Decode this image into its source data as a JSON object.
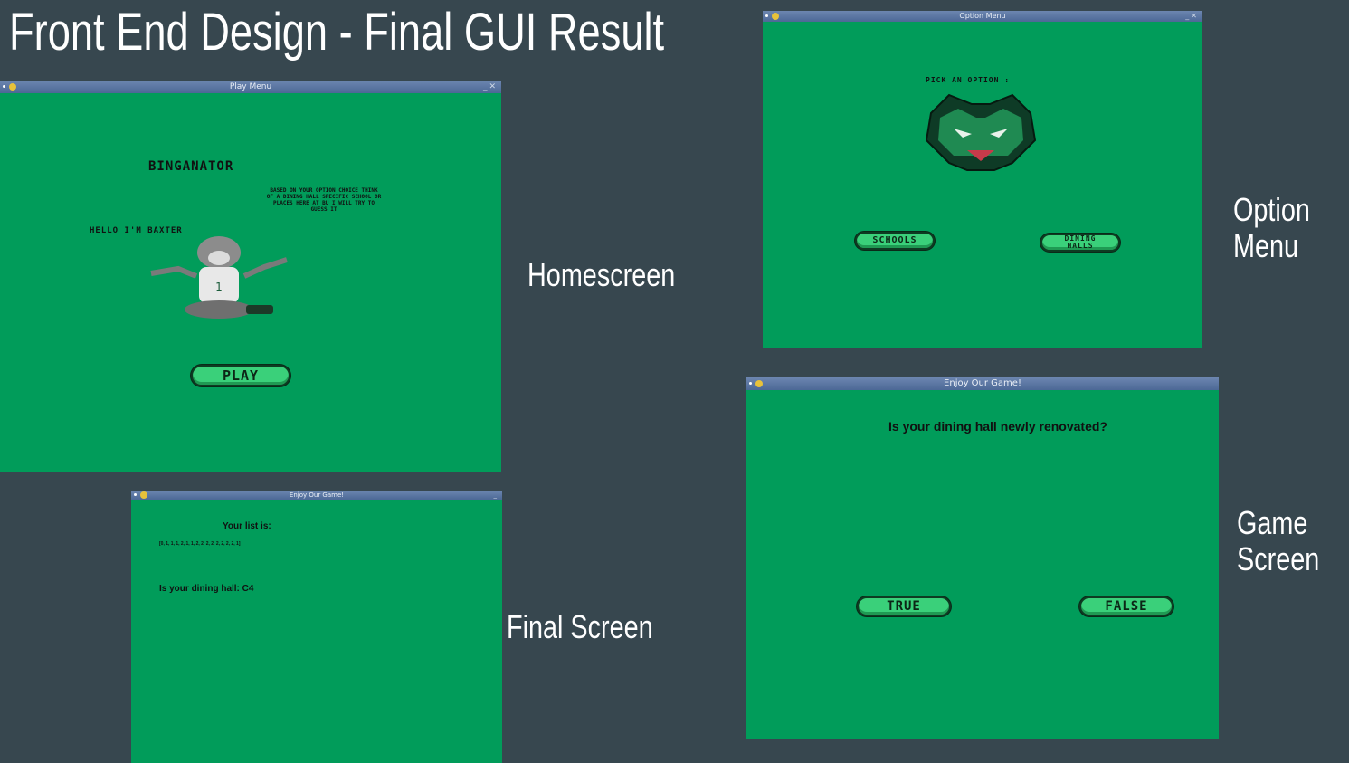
{
  "slide": {
    "title": "Front End Design - Final GUI Result",
    "captions": {
      "homescreen": "Homescreen",
      "option_menu_line1": "Option",
      "option_menu_line2": "Menu",
      "final_screen": "Final Screen",
      "game_screen_line1": "Game",
      "game_screen_line2": "Screen"
    }
  },
  "play_window": {
    "title": "Play Menu",
    "heading": "BINGANATOR",
    "description_lines": [
      "BASED ON YOUR OPTION CHOICE THINK",
      "OF A DINING HALL SPECIFIC SCHOOL OR",
      "PLACES HERE AT BU I WILL TRY TO",
      "GUESS IT"
    ],
    "hello": "HELLO I'M BAXTER",
    "play_button": "PLAY"
  },
  "option_window": {
    "title": "Option Menu",
    "prompt": "PICK AN OPTION :",
    "schools_button": "SCHOOLS",
    "dining_button_line1": "DINING",
    "dining_button_line2": "HALLS"
  },
  "final_window": {
    "title": "Enjoy Our Game!",
    "list_label": "Your list is:",
    "list_value": "[0, 1, 1, 1, 2, 1, 1, 2, 2, 2, 2, 2, 2, 2, 2, 1]",
    "result_text": "Is your dining hall: C4"
  },
  "game_window": {
    "title": "Enjoy Our Game!",
    "question": "Is your dining hall newly renovated?",
    "true_button": "TRUE",
    "false_button": "FALSE"
  },
  "colors": {
    "background": "#37474f",
    "window_green": "#019c5a",
    "button_green": "#3ad07a",
    "titlebar": "#5a76a3"
  }
}
